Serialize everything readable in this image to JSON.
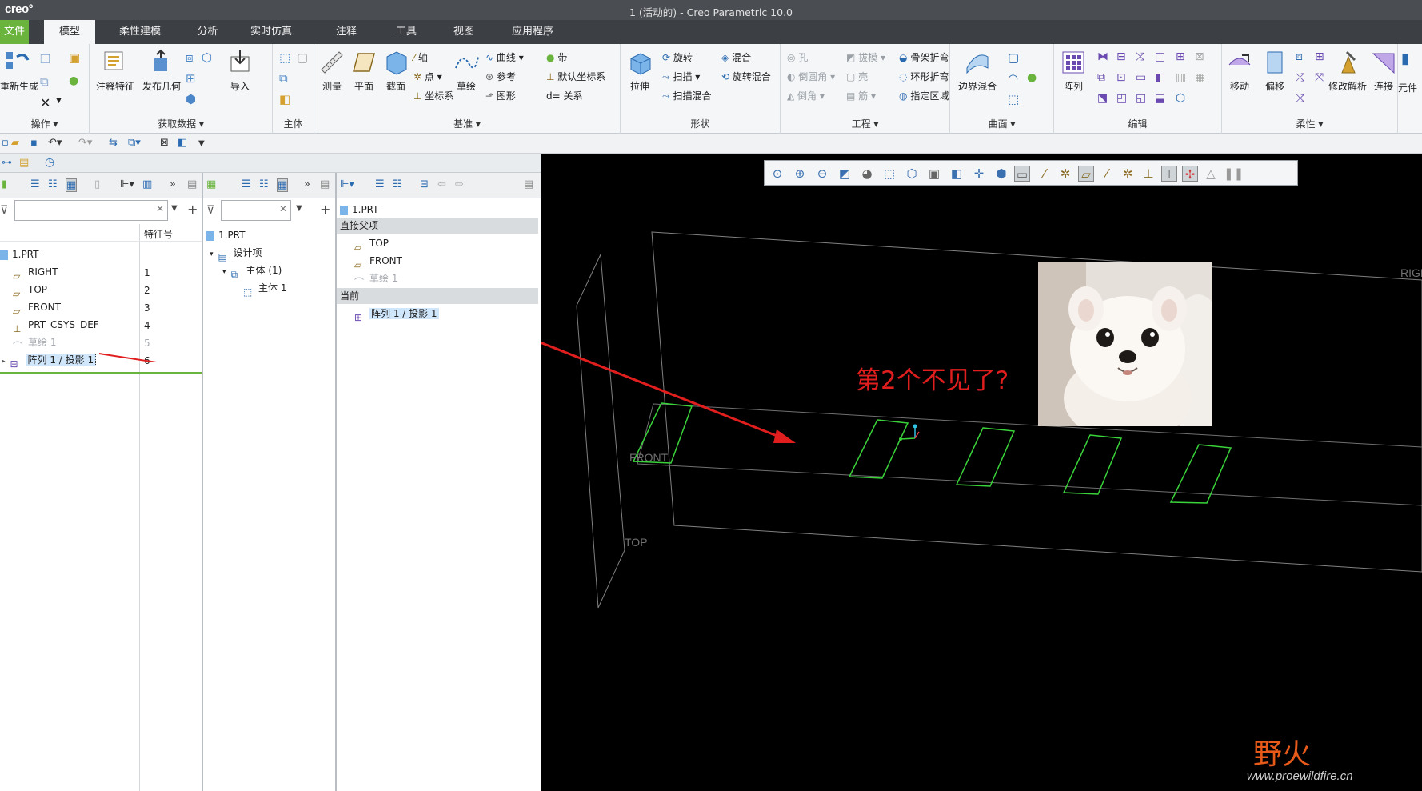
{
  "app": {
    "logo": "creo°",
    "title": "1 (活动的) - Creo Parametric 10.0"
  },
  "menu": {
    "tabs": [
      "文件",
      "模型",
      "柔性建模",
      "分析",
      "实时仿真",
      "注释",
      "工具",
      "视图",
      "应用程序"
    ],
    "active": "模型"
  },
  "ribbon": {
    "groups": {
      "operations": "操作",
      "get_data": "获取数据",
      "body": "主体",
      "datum": "基准",
      "shapes": "形状",
      "engineering": "工程",
      "surfaces": "曲面",
      "editing": "编辑",
      "flexible": "柔性"
    },
    "regen": "重新生成",
    "annot_feature": "注释特征",
    "publish_geom": "发布几何",
    "import": "导入",
    "measure": "测量",
    "plane": "平面",
    "section": "截面",
    "axis": "轴",
    "point": "点",
    "csys": "坐标系",
    "sketch": "草绘",
    "curve": "曲线",
    "ref": "参考",
    "graph": "图形",
    "ribbon_band": "带",
    "default_csys": "默认坐标系",
    "relation": "关系",
    "extrude": "拉伸",
    "revolve": "旋转",
    "sweep": "扫描",
    "swept_blend": "扫描混合",
    "blend": "混合",
    "rot_blend": "旋转混合",
    "hole": "孔",
    "round": "倒圆角",
    "chamfer": "倒角",
    "draft": "拔模",
    "shell": "壳",
    "rib": "筋",
    "spinal_bend": "骨架折弯",
    "toroidal_bend": "环形折弯",
    "specify_area": "指定区域",
    "boundary_blend": "边界混合",
    "pattern": "阵列",
    "move": "移动",
    "offset": "偏移",
    "modify_analysis": "修改解析",
    "connect": "连接",
    "extra": "元件"
  },
  "model_tree": {
    "col_header": "特征号",
    "items": [
      {
        "label": "1.PRT",
        "num": ""
      },
      {
        "label": "RIGHT",
        "num": "1"
      },
      {
        "label": "TOP",
        "num": "2"
      },
      {
        "label": "FRONT",
        "num": "3"
      },
      {
        "label": "PRT_CSYS_DEF",
        "num": "4"
      },
      {
        "label": "草绘 1",
        "num": "5"
      },
      {
        "label": "阵列 1 / 投影 1",
        "num": "6"
      }
    ]
  },
  "body_tree": {
    "items": [
      "1.PRT",
      "设计项",
      "主体 (1)",
      "主体 1"
    ]
  },
  "rel_panel": {
    "root": "1.PRT",
    "parents_header": "直接父项",
    "parents": [
      "TOP",
      "FRONT",
      "草绘 1"
    ],
    "current_header": "当前",
    "current": "阵列 1 / 投影 1"
  },
  "viewport": {
    "annotation": "第2个不见了?",
    "plane_labels": [
      "FRONT",
      "TOP",
      "RIGH"
    ],
    "watermark_logo": "野火",
    "watermark_url": "www.proewildfire.cn",
    "accent_red": "#e11e1e",
    "sketch_green": "#3ad43a"
  }
}
